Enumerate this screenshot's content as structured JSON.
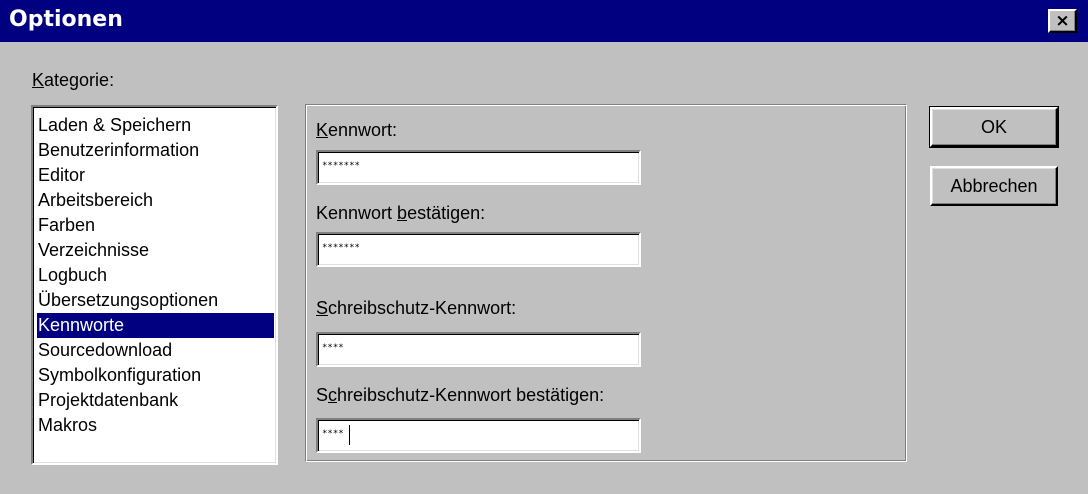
{
  "window": {
    "title": "Optionen",
    "close_symbol": "×"
  },
  "kategorie": {
    "label_mnemonic": "K",
    "label_rest": "ategorie:",
    "items": [
      {
        "label": "Laden & Speichern",
        "selected": false
      },
      {
        "label": "Benutzerinformation",
        "selected": false
      },
      {
        "label": "Editor",
        "selected": false
      },
      {
        "label": "Arbeitsbereich",
        "selected": false
      },
      {
        "label": "Farben",
        "selected": false
      },
      {
        "label": "Verzeichnisse",
        "selected": false
      },
      {
        "label": "Logbuch",
        "selected": false
      },
      {
        "label": "Übersetzungsoptionen",
        "selected": false
      },
      {
        "label": "Kennworte",
        "selected": true
      },
      {
        "label": "Sourcedownload",
        "selected": false
      },
      {
        "label": "Symbolkonfiguration",
        "selected": false
      },
      {
        "label": "Projektdatenbank",
        "selected": false
      },
      {
        "label": "Makros",
        "selected": false
      }
    ]
  },
  "fields": {
    "kennwort": {
      "label_pre": "",
      "label_mnemonic": "K",
      "label_post": "ennwort:",
      "value": "*******"
    },
    "kennwort_bestaetigen": {
      "label_pre": "Kennwort ",
      "label_mnemonic": "b",
      "label_post": "estätigen:",
      "value": "*******"
    },
    "schreibschutz": {
      "label_pre": "",
      "label_mnemonic": "S",
      "label_post": "chreibschutz-Kennwort:",
      "value": "****"
    },
    "schreibschutz_bestaetigen": {
      "label_pre": "S",
      "label_mnemonic": "c",
      "label_post": "hreibschutz-Kennwort bestätigen:",
      "value": "****"
    }
  },
  "buttons": {
    "ok": "OK",
    "cancel": "Abbrechen"
  },
  "colors": {
    "titlebar": "#000080",
    "face": "#c0c0c0",
    "selection": "#000080"
  }
}
